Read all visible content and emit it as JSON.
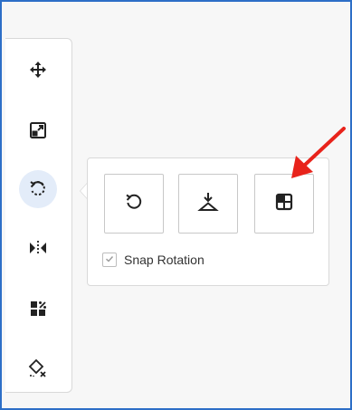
{
  "toolbar": {
    "tools": [
      {
        "icon": "move-icon",
        "active": false
      },
      {
        "icon": "resize-icon",
        "active": false
      },
      {
        "icon": "rotate-icon",
        "active": true
      },
      {
        "icon": "flip-icon",
        "active": false
      },
      {
        "icon": "arrange-icon",
        "active": false
      },
      {
        "icon": "clear-style-icon",
        "active": false
      }
    ]
  },
  "rotate_popover": {
    "options": [
      {
        "icon": "rotate-free-icon"
      },
      {
        "icon": "rotate-to-horizontal-icon"
      },
      {
        "icon": "rotate-quadrant-icon"
      }
    ],
    "snap_label": "Snap Rotation",
    "snap_checked": true
  },
  "colors": {
    "accent": "#2d6fc7",
    "active_tool_bg": "#e3ecf9",
    "icon": "#222222",
    "annotation_arrow": "#e8231b"
  }
}
